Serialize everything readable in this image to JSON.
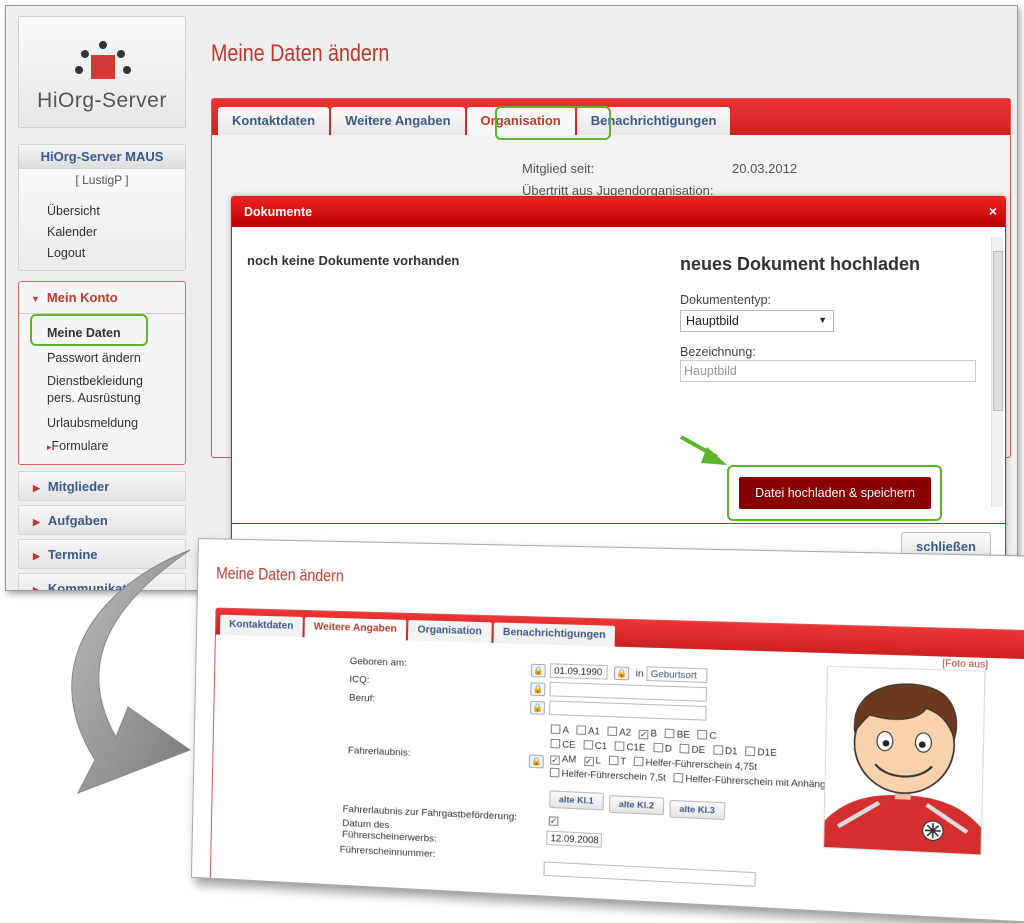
{
  "logo": {
    "text": "HiOrg-Server"
  },
  "sidebar": {
    "org_name": "HiOrg-Server MAUS",
    "user": "[ LustigP ]",
    "links": [
      "Übersicht",
      "Kalender",
      "Logout"
    ],
    "konto": {
      "title": "Mein Konto",
      "items": [
        "Meine Daten",
        "Passwort ändern",
        "Dienstbekleidung pers. Ausrüstung",
        "Urlaubsmeldung",
        "Formulare"
      ]
    },
    "nav": [
      "Mitglieder",
      "Aufgaben",
      "Termine",
      "Kommunikati"
    ]
  },
  "page": {
    "title": "Meine Daten ändern",
    "tabs": [
      "Kontaktdaten",
      "Weitere Angaben",
      "Organisation",
      "Benachrichtigungen"
    ],
    "active_tab": "Organisation",
    "member_since_label": "Mitglied seit:",
    "member_since_value": "20.03.2012",
    "transfer_label": "Übertritt aus Jugendorganisation:"
  },
  "modal": {
    "title": "Dokumente",
    "close_glyph": "×",
    "empty_text": "noch keine Dokumente vorhanden",
    "upload_title": "neues Dokument hochladen",
    "doctype_label": "Dokumententyp:",
    "doctype_value": "Hauptbild",
    "name_label": "Bezeichnung:",
    "name_placeholder": "Hauptbild",
    "upload_button": "Datei hochladen & speichern",
    "close_button": "schließen"
  },
  "second": {
    "title": "Meine Daten ändern",
    "tabs": [
      "Kontaktdaten",
      "Weitere Angaben",
      "Organisation",
      "Benachrichtigungen"
    ],
    "active_tab": "Weitere Angaben",
    "foto_link": "[Foto aus]",
    "born_label": "Geboren am:",
    "born_value": "01.09.1990",
    "in_label": "in",
    "birthplace_placeholder": "Geburtsort",
    "icq_label": "ICQ:",
    "job_label": "Beruf:",
    "license_label": "Fahrerlaubnis:",
    "license_classes_row1": [
      {
        "label": "A",
        "checked": false
      },
      {
        "label": "A1",
        "checked": false
      },
      {
        "label": "A2",
        "checked": false
      },
      {
        "label": "B",
        "checked": true
      },
      {
        "label": "BE",
        "checked": false
      },
      {
        "label": "C",
        "checked": false
      }
    ],
    "license_classes_row2": [
      {
        "label": "CE",
        "checked": false
      },
      {
        "label": "C1",
        "checked": false
      },
      {
        "label": "C1E",
        "checked": false
      },
      {
        "label": "D",
        "checked": false
      },
      {
        "label": "DE",
        "checked": false
      },
      {
        "label": "D1",
        "checked": false
      },
      {
        "label": "D1E",
        "checked": false
      }
    ],
    "license_classes_row3": [
      {
        "label": "AM",
        "checked": true
      },
      {
        "label": "L",
        "checked": true
      },
      {
        "label": "T",
        "checked": false
      },
      {
        "label": "Helfer-Führerschein 4,75t",
        "checked": false
      }
    ],
    "license_classes_row4": [
      {
        "label": "Helfer-Führerschein 7,5t",
        "checked": false
      },
      {
        "label": "Helfer-Führerschein mit Anhänger",
        "checked": false
      }
    ],
    "old_buttons": [
      "alte Kl.1",
      "alte Kl.2",
      "alte Kl.3"
    ],
    "passenger_label": "Fahrerlaubnis zur Fahrgastbeförderung:",
    "issue_label_1": "Datum des",
    "issue_label_2": "Führerscheinerwerbs:",
    "issue_value": "12.09.2008",
    "license_no_label": "Führerscheinnummer:"
  }
}
